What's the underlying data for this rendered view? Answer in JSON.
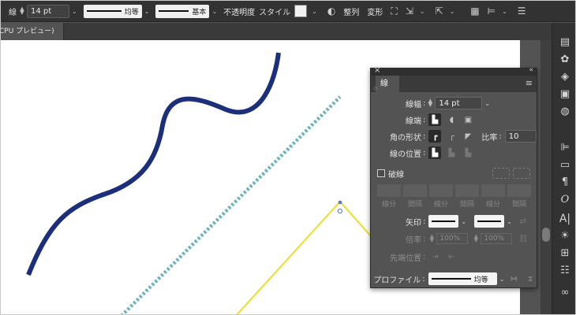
{
  "control_bar": {
    "stroke_label": "線",
    "stroke_value": "14 pt",
    "profile_label": "均等",
    "brush_label": "基本",
    "opacity_label": "不透明度",
    "style_label": "スタイル",
    "align_label": "整列",
    "transform_label": "変形"
  },
  "document_tab": {
    "title": "CPU プレビュー)"
  },
  "stroke_panel": {
    "tab_label": "線",
    "weight_label": "線幅",
    "weight_value": "14 pt",
    "cap_label": "線端",
    "corner_label": "角の形状",
    "limit_label": "比率",
    "limit_value": "10",
    "align_stroke_label": "線の位置",
    "dashed_label": "破線",
    "dash_labels": [
      "線分",
      "間隔",
      "線分",
      "間隔",
      "線分",
      "間隔"
    ],
    "arrow_label": "矢印",
    "scale_label": "倍率",
    "scale_start": "100%",
    "scale_end": "100%",
    "align_arrow_label": "先端位置",
    "profile_label": "プロファイル",
    "profile_value": "均等"
  },
  "colors": {
    "navy_path": "#1c2f7a",
    "teal_dotted": "#6fb3bd",
    "yellow_path": "#f0e13a",
    "panel_bg": "#535353",
    "bar_bg": "#323232"
  }
}
